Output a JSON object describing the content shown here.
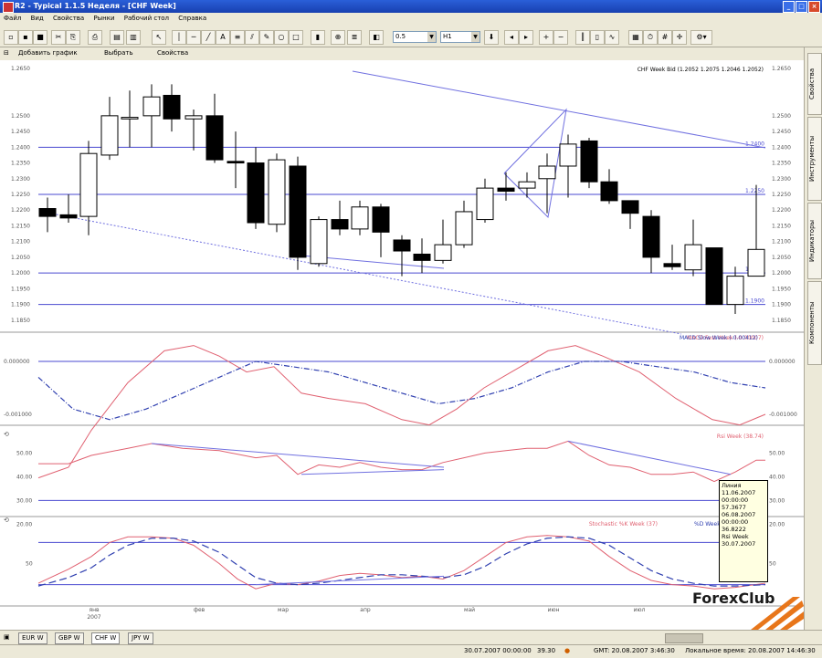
{
  "window": {
    "title": "R2 - Typical 1.1.5 Неделя - [CHF Week]",
    "buttons": [
      "_",
      "□",
      "×"
    ]
  },
  "menu": [
    "Файл",
    "Вид",
    "Свойства",
    "Рынки",
    "Рабочий стол",
    "Справка"
  ],
  "toolbar": {
    "size_value": "0.5",
    "timeframe_value": "H1"
  },
  "chart_toolbar": {
    "add_chart": "Добавить график",
    "select": "Выбрать",
    "properties": "Свойства"
  },
  "price_panel": {
    "header": "CHF Week Bid (1.2052 1.2075 1.2046 1.2052)",
    "left_ticks": [
      "1.2650",
      "1.2500",
      "1.2450",
      "1.2400",
      "1.2350",
      "1.2300",
      "1.2250",
      "1.2200",
      "1.2150",
      "1.2100",
      "1.2050",
      "1.2000",
      "1.1950",
      "1.1900",
      "1.1850"
    ],
    "right_ticks": [
      "1.2650",
      "1.2500",
      "1.2450",
      "1.2400",
      "1.2350",
      "1.2300",
      "1.2250",
      "1.2200",
      "1.2150",
      "1.2100",
      "1.2050",
      "1.2000",
      "1.1950",
      "1.1900",
      "1.1850"
    ],
    "level_labels": [
      "1.2400",
      "1.2250",
      "1.2000",
      "1.1900"
    ]
  },
  "macd_panel": {
    "header_fast": "MACD Fast Week (-0.00007)",
    "header_slow": "MACD Slow Week (-0.00412)",
    "left_ticks": [
      "0.000000",
      "-0.001000"
    ],
    "right_ticks": [
      "0.000000",
      "-0.001000"
    ]
  },
  "rsi_panel": {
    "header": "Rsi Week (38.74)",
    "left_ticks": [
      "50.00",
      "40.00",
      "30.00",
      "20.00"
    ],
    "right_ticks": [
      "50.00",
      "40.00",
      "30.00",
      "20.00"
    ]
  },
  "stoch_panel": {
    "header_main": "Stochastic %K Week (37)",
    "header_sig": "%D Week (40)",
    "left_ticks": [
      "50"
    ],
    "right_ticks": [
      "50"
    ]
  },
  "x_axis": [
    {
      "label": "янв",
      "sub": "2007"
    },
    {
      "label": "фев",
      "sub": ""
    },
    {
      "label": "мар",
      "sub": ""
    },
    {
      "label": "апр",
      "sub": ""
    },
    {
      "label": "май",
      "sub": ""
    },
    {
      "label": "июн",
      "sub": ""
    },
    {
      "label": "июл",
      "sub": ""
    }
  ],
  "tooltip": [
    "Линия",
    "11.06.2007",
    "00:00:00",
    "57.3677",
    "06.08.2007",
    "00:00:00",
    "36.8222",
    "Rsi Week",
    "30.07.2007"
  ],
  "logo_text": "ForexClub",
  "side_tabs": [
    "Свойства",
    "Инструменты",
    "Индикаторы",
    "Компоненты"
  ],
  "bottom_tabs": [
    "EUR W",
    "GBP W",
    "CHF W",
    "JPY W"
  ],
  "status": {
    "left": "30.07.2007 00:00:00",
    "middle": "39.30",
    "gmt": "GMT: 20.08.2007 3:46:30",
    "local": "Локальное время: 20.08.2007 14:46:30"
  },
  "colors": {
    "bull": "#ffffff",
    "bear": "#000000",
    "level": "#4a4ad0",
    "macd_fast": "#e06070",
    "macd_slow": "#3040b0",
    "trend": "#7070e0"
  }
}
